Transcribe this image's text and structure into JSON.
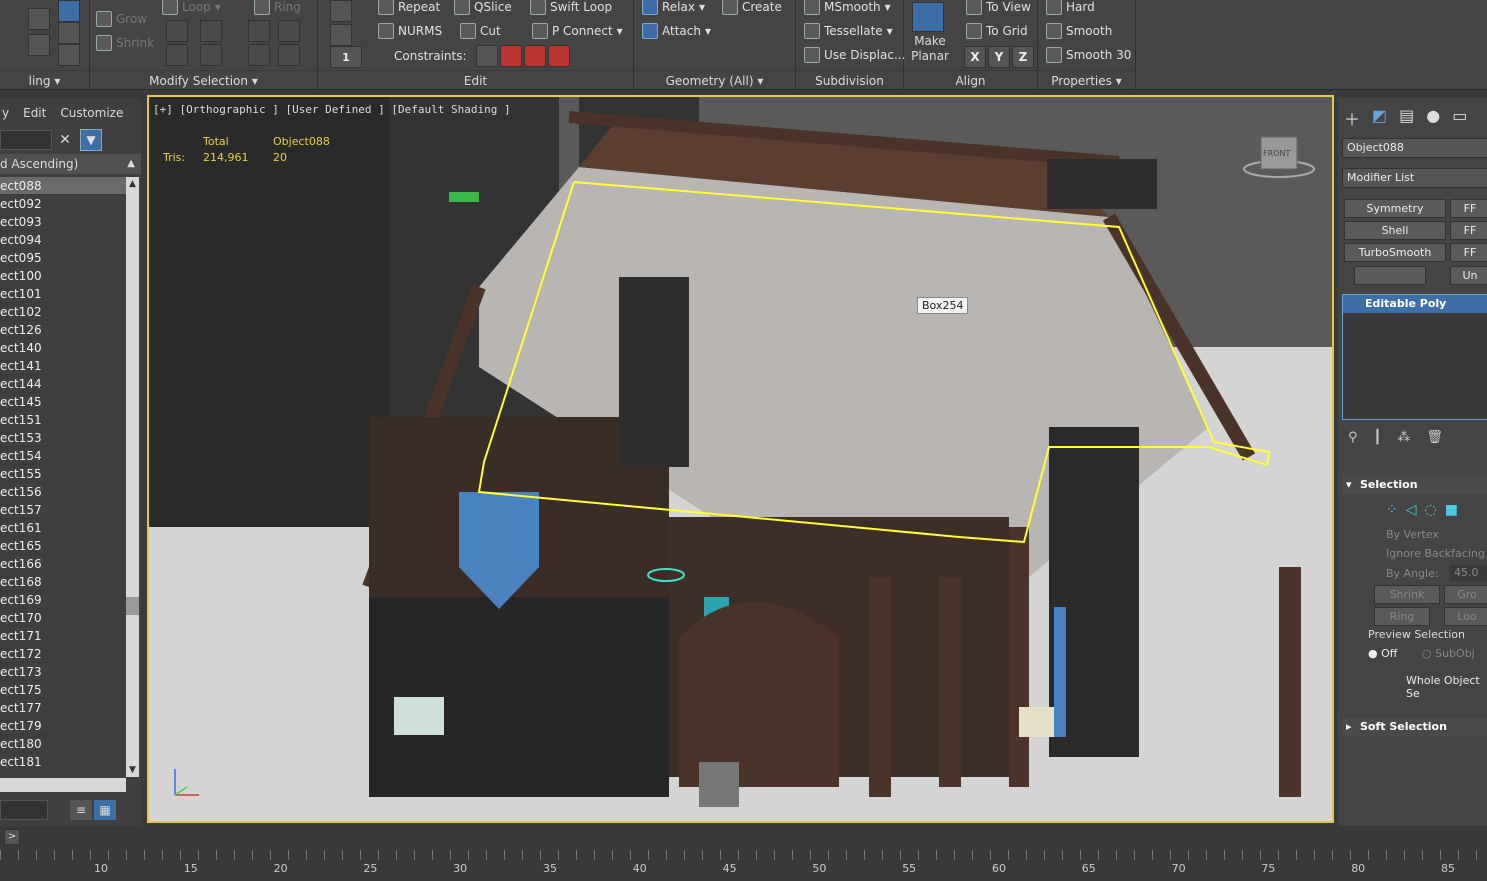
{
  "ribbon": {
    "row1": [
      "Grow",
      "Shrink",
      "Loop",
      "Ring"
    ],
    "modify_selection_label": "Modify Selection",
    "edit": {
      "repeat": "Repeat",
      "qslice": "QSlice",
      "swift_loop": "Swift Loop",
      "nurms": "NURMS",
      "cut": "Cut",
      "p_connect": "P Connect",
      "constraints": "Constraints:",
      "label": "Edit"
    },
    "geometry": {
      "relax": "Relax",
      "create": "Create",
      "attach": "Attach",
      "label": "Geometry (All)"
    },
    "subdivision": {
      "msmooth": "MSmooth",
      "tessellate": "Tessellate",
      "use_displace": "Use Displac...",
      "label": "Subdivision"
    },
    "align": {
      "make_planar": "Make Planar",
      "to_view": "To View",
      "to_grid": "To Grid",
      "x": "X",
      "y": "Y",
      "z": "Z",
      "label": "Align"
    },
    "properties": {
      "hard": "Hard",
      "smooth": "Smooth",
      "smooth30": "Smooth 30",
      "label": "Properties"
    },
    "left_label": "ling"
  },
  "left_panel": {
    "menu": [
      "y",
      "Edit",
      "Customize"
    ],
    "sort_label": "d Ascending)",
    "items": [
      "ect088",
      "ect092",
      "ect093",
      "ect094",
      "ect095",
      "ect100",
      "ect101",
      "ect102",
      "ect126",
      "ect140",
      "ect141",
      "ect144",
      "ect145",
      "ect151",
      "ect153",
      "ect154",
      "ect155",
      "ect156",
      "ect157",
      "ect161",
      "ect165",
      "ect166",
      "ect168",
      "ect169",
      "ect170",
      "ect171",
      "ect172",
      "ect173",
      "ect175",
      "ect177",
      "ect179",
      "ect180",
      "ect181"
    ]
  },
  "viewport": {
    "label": "[+] [Orthographic ] [User Defined ] [Default Shading ]",
    "stats_total": "Total",
    "stats_object": "Object088",
    "tris_label": "Tris:",
    "tris_total": "214,961",
    "tris_object": "20",
    "tooltip": "Box254",
    "viewcube_label": "FRONT"
  },
  "right_panel": {
    "object_name": "Object088",
    "modifier_list": "Modifier List",
    "modifiers": [
      "Symmetry",
      "Shell",
      "TurboSmooth"
    ],
    "modifiers_right": [
      "FF",
      "FF",
      "FF",
      "Un"
    ],
    "stack_item": "Editable Poly",
    "selection": "Selection",
    "by_vertex": "By Vertex",
    "ignore_backfacing": "Ignore Backfacing",
    "by_angle": "By Angle:",
    "angle_value": "45.0",
    "shrink": "Shrink",
    "grow": "Gro",
    "ring": "Ring",
    "loop": "Loo",
    "preview_selection": "Preview Selection",
    "off": "Off",
    "subobj": "SubObj",
    "whole_object": "Whole Object Se",
    "soft_selection": "Soft Selection"
  },
  "timeline": {
    "ticks": [
      "10",
      "15",
      "20",
      "25",
      "30",
      "35",
      "40",
      "45",
      "50",
      "55",
      "60",
      "65",
      "70",
      "75",
      "80",
      "85"
    ]
  },
  "colors": {
    "accent": "#3d6ea5",
    "viewport_border": "#e5c84a",
    "selection_outline": "#ffff33"
  }
}
